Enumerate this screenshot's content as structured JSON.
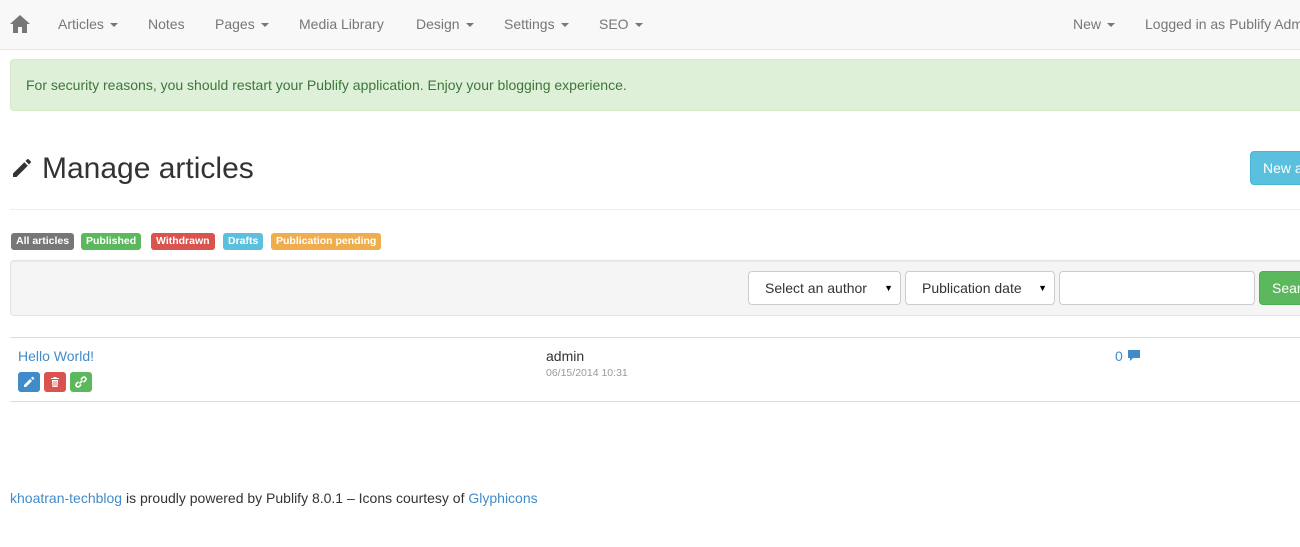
{
  "navbar": {
    "home_icon": "home-icon",
    "left_items": [
      {
        "label": "Articles",
        "dropdown": true
      },
      {
        "label": "Notes",
        "dropdown": false
      },
      {
        "label": "Pages",
        "dropdown": true
      },
      {
        "label": "Media Library",
        "dropdown": false
      },
      {
        "label": "Design",
        "dropdown": true
      },
      {
        "label": "Settings",
        "dropdown": true
      },
      {
        "label": "SEO",
        "dropdown": true
      }
    ],
    "new_label": "New",
    "logged_in_label": "Logged in as Publify Admin"
  },
  "alert": {
    "message": "For security reasons, you should restart your Publify application. Enjoy your blogging experience."
  },
  "header": {
    "title": "Manage articles",
    "title_icon": "pencil-icon",
    "new_button_label": "New article"
  },
  "filters": {
    "labels": [
      {
        "text": "All articles",
        "color": "#777777"
      },
      {
        "text": "Published",
        "color": "#5cb85c"
      },
      {
        "text": "Withdrawn",
        "color": "#d9534f"
      },
      {
        "text": "Drafts",
        "color": "#5bc0de"
      },
      {
        "text": "Publication pending",
        "color": "#f0ad4e"
      }
    ],
    "author_select": "Select an author",
    "date_select": "Publication date",
    "search_value": "",
    "search_button_label": "Search"
  },
  "articles": [
    {
      "title": "Hello World!",
      "author": "admin",
      "date": "06/15/2014 10:31",
      "comments": "0",
      "actions": [
        "edit-icon",
        "trash-icon",
        "link-icon"
      ]
    }
  ],
  "footer": {
    "blog_name": "khoatran-techblog",
    "text": " is proudly powered by Publify 8.0.1 – Icons courtesy of ",
    "glyphicons": "Glyphicons"
  },
  "colors": {
    "primary": "#428bca",
    "success": "#5cb85c",
    "danger": "#d9534f",
    "info": "#5bc0de",
    "warning": "#f0ad4e",
    "alert_bg": "#dff0d8",
    "alert_text": "#3c763d"
  }
}
